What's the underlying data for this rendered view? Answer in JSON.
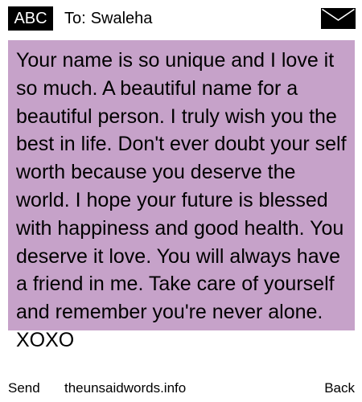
{
  "header": {
    "badge_label": "ABC",
    "to_label": "To:",
    "recipient": "Swaleha",
    "envelope_icon": "envelope-icon"
  },
  "message": {
    "background_color": "#c6a2c9",
    "body": "Your name is so unique and I love it so much. A beautiful name for a beautiful person. I truly wish you the best in life. Don't ever doubt your self worth because you deserve the world. I hope your future is blessed with happiness and good health. You deserve it love. You will always have a friend in me. Take care of yourself and remember you're never alone. XOXO"
  },
  "footer": {
    "send_label": "Send",
    "site_label": "theunsaidwords.info",
    "back_label": "Back"
  }
}
